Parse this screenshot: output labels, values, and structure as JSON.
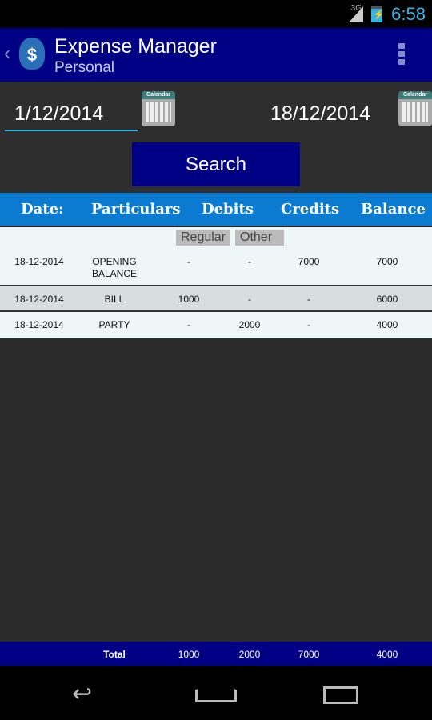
{
  "status": {
    "network": "3G",
    "time": "6:58"
  },
  "appbar": {
    "title": "Expense Manager",
    "subtitle": "Personal"
  },
  "filter": {
    "from_date": "1/12/2014",
    "to_date": "18/12/2014",
    "calendar_label": "Calendar",
    "search_label": "Search"
  },
  "table": {
    "headers": [
      "Date:",
      "Particulars",
      "Debits",
      "Credits",
      "Balance"
    ],
    "debit_sub": [
      "Regular",
      "Other"
    ],
    "rows": [
      {
        "date": "18-12-2014",
        "particulars": "OPENING\nBALANCE",
        "regular": "-",
        "other": "-",
        "credits": "7000",
        "balance": "7000"
      },
      {
        "date": "18-12-2014",
        "particulars": "BILL",
        "regular": "1000",
        "other": "-",
        "credits": "-",
        "balance": "6000"
      },
      {
        "date": "18-12-2014",
        "particulars": "PARTY",
        "regular": "-",
        "other": "2000",
        "credits": "-",
        "balance": "4000"
      }
    ],
    "total": {
      "label": "Total",
      "regular": "1000",
      "other": "2000",
      "credits": "7000",
      "balance": "4000"
    }
  }
}
